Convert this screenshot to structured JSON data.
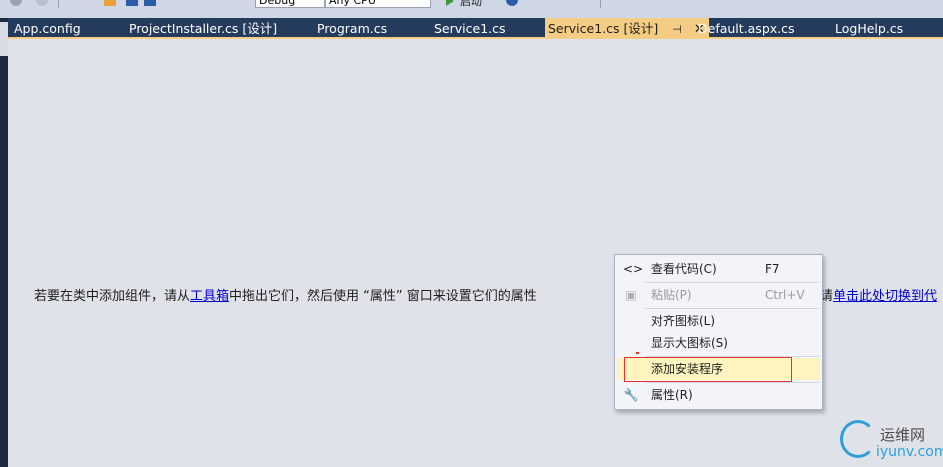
{
  "toolbar": {
    "config_value": "Debug",
    "platform_value": "Any CPU",
    "start_label": "启动"
  },
  "tabs": [
    {
      "label": "App.config"
    },
    {
      "label": "ProjectInstaller.cs [设计]"
    },
    {
      "label": "Program.cs"
    },
    {
      "label": "Service1.cs"
    },
    {
      "label": "Service1.cs [设计]",
      "active": true
    },
    {
      "label": "Default.aspx.cs"
    },
    {
      "label": "LogHelp.cs"
    }
  ],
  "designer": {
    "hint_before": "若要在类中添加组件，请从",
    "toolbox_link": "工具箱",
    "hint_after": "中拖出它们，然后使用 “属性” 窗口来设置它们的属性",
    "right_prefix": "请",
    "code_view_link": "单击此处切换到代"
  },
  "context_menu": {
    "items": [
      {
        "label": "查看代码(C)",
        "shortcut": "F7",
        "icon": "code-icon"
      },
      {
        "label": "粘贴(P)",
        "shortcut": "Ctrl+V",
        "icon": "paste-icon",
        "disabled": true
      },
      {
        "label": "对齐图标(L)"
      },
      {
        "label": "显示大图标(S)"
      },
      {
        "label": "添加安装程序",
        "highlighted": true
      },
      {
        "label": "属性(R)",
        "icon": "wrench-icon"
      }
    ]
  },
  "watermark": {
    "cn": "运维网",
    "en": "iyunv.com"
  },
  "colors": {
    "tab_bg": "#253b5d",
    "active_tab": "#f5cc84",
    "designer_bg": "#dfe2e9",
    "highlight_box": "#e53030",
    "watermark_blue": "#2f9fd8"
  }
}
